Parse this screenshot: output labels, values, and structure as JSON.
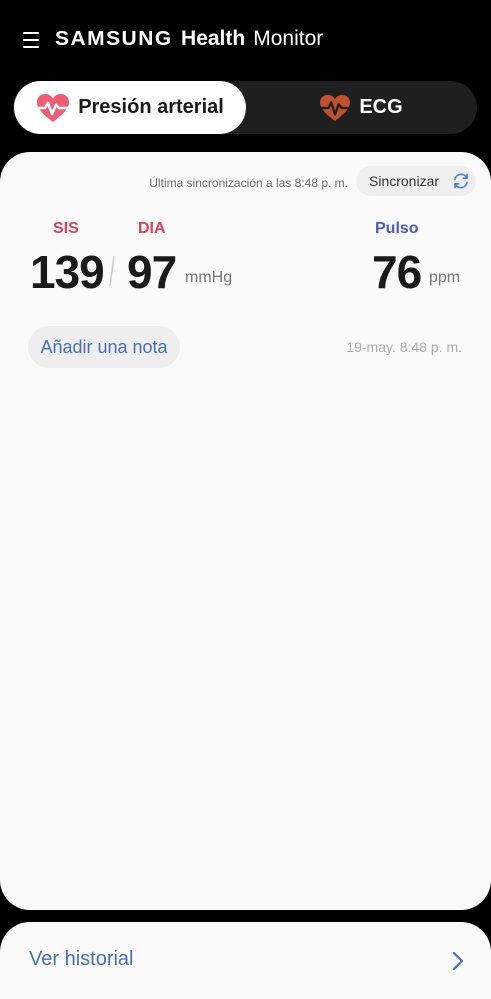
{
  "header": {
    "brand": "SAMSUNG",
    "title_health": "Health",
    "title_monitor": "Monitor",
    "menu_icon": "hamburger-menu-icon"
  },
  "tabs": [
    {
      "label": "Presión arterial",
      "icon": "heart-pulse-icon",
      "selected": true,
      "icon_color": "#ef5d75"
    },
    {
      "label": "ECG",
      "icon": "heart-ecg-icon",
      "selected": false,
      "icon_color": "#c0502e"
    }
  ],
  "sync": {
    "last_sync_text": "Última sincronización a las 8:48 p. m.",
    "button_label": "Sincronizar",
    "icon": "sync-icon"
  },
  "reading": {
    "sis_label": "SIS",
    "dia_label": "DIA",
    "pulse_label": "Pulso",
    "sis_value": "139",
    "dia_value": "97",
    "pressure_unit": "mmHg",
    "pulse_value": "76",
    "pulse_unit": "ppm",
    "add_note_label": "Añadir una nota",
    "timestamp": "19-may. 8:48 p. m."
  },
  "footer": {
    "history_label": "Ver historial",
    "icon": "chevron-right-icon"
  },
  "colors": {
    "background": "#000000",
    "card": "#fafafa",
    "systolic_accent": "#d9435a",
    "pulse_accent": "#4c5cba",
    "link_blue": "#4a6fb8",
    "sync_icon": "#4d7fcf"
  }
}
